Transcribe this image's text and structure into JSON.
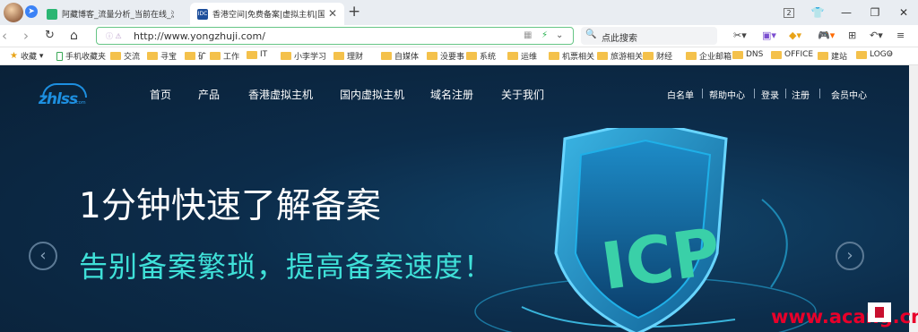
{
  "tabs": [
    {
      "title": "阿藏博客_流量分析_当前在线_浏",
      "active": false
    },
    {
      "title": "香港空间|免费备案|虚拟主机|国",
      "active": true
    }
  ],
  "window_controls": {
    "tab_count": "2"
  },
  "address_bar": {
    "url": "http://www.yongzhuji.com/",
    "security_label": "ⓘ ⚠"
  },
  "search": {
    "placeholder": "点此搜索"
  },
  "bookmarks": {
    "favorites_label": "收藏",
    "mobile_label": "手机收藏夹",
    "folders": [
      "交流",
      "寻宝",
      "矿",
      "工作",
      "IT",
      "小李学习",
      "理财",
      "自媒体",
      "没要事",
      "系统",
      "运维",
      "机票相关",
      "旅游相关",
      "财经",
      "企业邮箱",
      "DNS",
      "OFFICE",
      "建站",
      "LOGO"
    ],
    "more": "»"
  },
  "site": {
    "logo_text": "zhlss",
    "logo_sub": "com",
    "nav": [
      "首页",
      "产品",
      "香港虚拟主机",
      "国内虚拟主机",
      "域名注册",
      "关于我们"
    ],
    "user_nav": [
      "白名单",
      "帮助中心",
      "登录",
      "注册",
      "会员中心"
    ],
    "hero_title": "1分钟快速了解备案",
    "hero_subtitle": "告别备案繁琐，提高备案速度！",
    "shield_text": "ICP"
  },
  "watermark": "www.acang.cn",
  "colors": {
    "accent_green": "#66c585",
    "hero_cyan": "#3fe0d8",
    "site_bg": "#0c2c4a",
    "watermark_red": "#e8002a"
  }
}
